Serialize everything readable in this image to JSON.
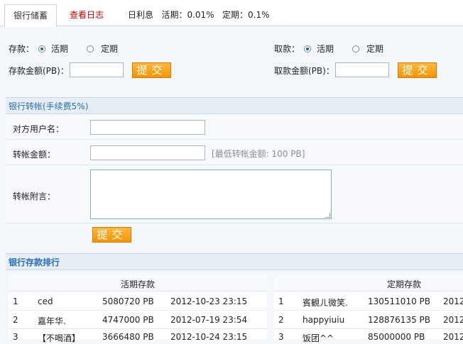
{
  "tabs": {
    "bank_savings": "银行储蓄",
    "view_log": "查看日志"
  },
  "rate": {
    "daily_label": "日利息",
    "current_label": "活期：0.01%",
    "fixed_label": "定期：0.1%"
  },
  "deposit": {
    "label": "存款：",
    "opt_current": "活期",
    "opt_fixed": "定期",
    "amount_label": "存款金额(PB)：",
    "submit": "提交"
  },
  "withdraw": {
    "label": "取款：",
    "opt_current": "活期",
    "opt_fixed": "定期",
    "amount_label": "取款金额(PB)：",
    "submit": "提交"
  },
  "transfer": {
    "title": "银行转帐(手续费5%)",
    "recipient_label": "对方用户名：",
    "amount_label": "转帐金额：",
    "min_hint": "[最低转帐金额: 100 PB]",
    "note_label": "转帐附言：",
    "submit": "提交"
  },
  "ranking": {
    "title": "银行存款排行",
    "current_header": "活期存款",
    "fixed_header": "定期存款",
    "current_rows": [
      {
        "rank": "1",
        "name": "ced",
        "amount": "5080720 PB",
        "time": "2012-10-23 23:15"
      },
      {
        "rank": "2",
        "name": "嘉年华.",
        "amount": "4747000 PB",
        "time": "2012-07-19 23:54"
      },
      {
        "rank": "3",
        "name": "【不喝酒】",
        "amount": "3666480 PB",
        "time": "2012-10-24 23:15"
      }
    ],
    "fixed_rows": [
      {
        "rank": "1",
        "name": "賓観ㄦ微笑.",
        "amount": "130511010 PB",
        "time": "2012"
      },
      {
        "rank": "2",
        "name": "happyiuiu",
        "amount": "128876135 PB",
        "time": "2012"
      },
      {
        "rank": "3",
        "name": "饭团^^",
        "amount": "85000000 PB",
        "time": "2012"
      }
    ]
  },
  "colors": {
    "accent": "#2b6fb6",
    "button": "#f29400",
    "log_tab": "#cc0000"
  }
}
